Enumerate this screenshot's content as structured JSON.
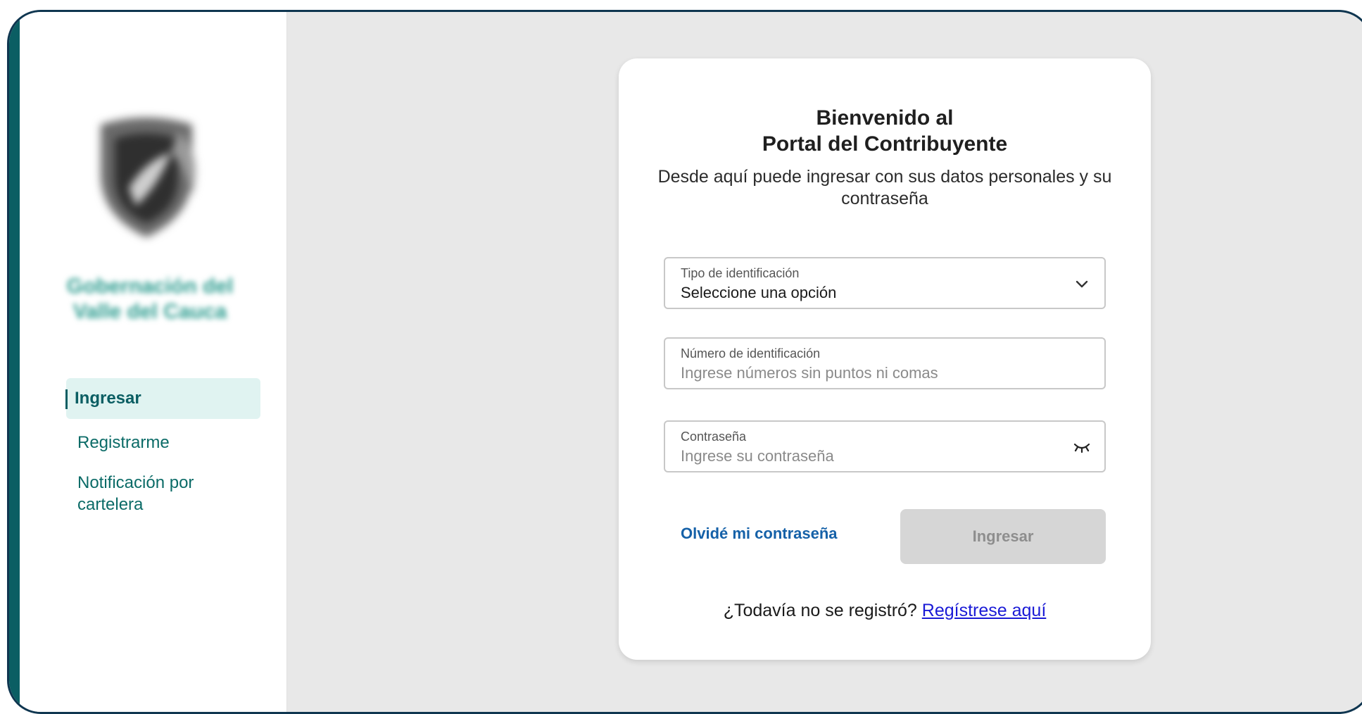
{
  "sidebar": {
    "org_name": "Gobernación del Valle del Cauca",
    "nav": [
      {
        "label": "Ingresar",
        "active": true
      },
      {
        "label": "Registrarme",
        "active": false
      },
      {
        "label": "Notificación por cartelera",
        "active": false
      }
    ]
  },
  "login": {
    "title_line1": "Bienvenido al",
    "title_line2": "Portal del Contribuyente",
    "subtitle": "Desde aquí puede ingresar con sus datos personales y su contraseña",
    "id_type": {
      "label": "Tipo de identificación",
      "value": "Seleccione una opción",
      "icon": "chevron-down-icon"
    },
    "id_number": {
      "label": "Número de identificación",
      "placeholder": "Ingrese números sin puntos ni comas"
    },
    "password": {
      "label": "Contraseña",
      "placeholder": "Ingrese su contraseña",
      "icon": "eye-closed-icon"
    },
    "forgot_label": "Olvidé mi contraseña",
    "submit_label": "Ingresar",
    "register_prompt": "¿Todavía no se registró?",
    "register_link": "Regístrese aquí"
  },
  "colors": {
    "accent": "#0b5e63",
    "link_blue": "#1561a8",
    "disabled_button": "#d6d6d6",
    "background": "#e8e8e8"
  }
}
